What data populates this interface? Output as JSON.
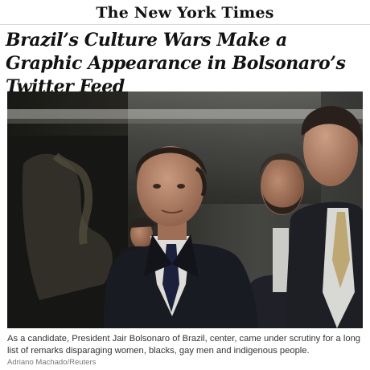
{
  "masthead": {
    "title": "The New York Times"
  },
  "article": {
    "headline": "Brazil’s Culture Wars Make a Graphic Appearance in Bolsonaro’s Twitter Feed",
    "image": {
      "subject": "news-photo"
    },
    "caption": "As a candidate, President Jair Bolsonaro of Brazil, center, came under scrutiny for a long list of remarks disparaging women, blacks, gay men and indigenous people.",
    "credit": "Adriano Machado/Reuters"
  }
}
